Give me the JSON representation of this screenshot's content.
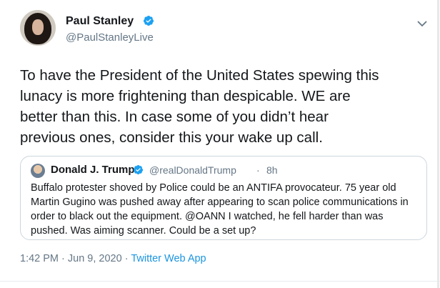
{
  "author": {
    "name": "Paul Stanley",
    "handle": "@PaulStanleyLive"
  },
  "tweet": {
    "text": "To have the President of the United States spewing this\nlunacy is more frightening than despicable. WE are\nbetter than this. In case some of you didn’t hear\nprevious ones, consider this your wake up call."
  },
  "quoted": {
    "name": "Donald J. Trump",
    "handle": "@realDonaldTrump",
    "dot": "·",
    "time": "8h",
    "text": "Buffalo protester shoved by Police could be an ANTIFA provocateur. 75 year old Martin Gugino was pushed away after appearing to scan police communications in order to black out the equipment. @OANN  I watched, he fell harder than was pushed. Was aiming scanner. Could be a set up?"
  },
  "meta": {
    "time": "1:42 PM",
    "separator1": " · ",
    "date": "Jun 9, 2020",
    "separator2": " · ",
    "source": "Twitter Web App"
  },
  "icons": {
    "verified": "verified-badge-icon",
    "menu": "chevron-down-icon"
  },
  "colors": {
    "verified": "#1da1f2",
    "link": "#1b95e0",
    "secondary": "#657786",
    "border": "#ccd6dd"
  }
}
